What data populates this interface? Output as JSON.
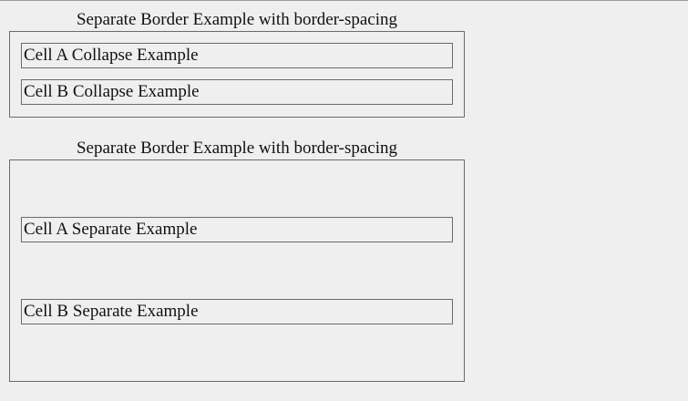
{
  "tables": [
    {
      "caption": "Separate Border Example with border-spacing",
      "cells": [
        {
          "label": "Cell A Collapse Example"
        },
        {
          "label": "Cell B Collapse Example"
        }
      ]
    },
    {
      "caption": "Separate Border Example with border-spacing",
      "cells": [
        {
          "label": "Cell A Separate Example"
        },
        {
          "label": "Cell B Separate Example"
        }
      ]
    }
  ]
}
